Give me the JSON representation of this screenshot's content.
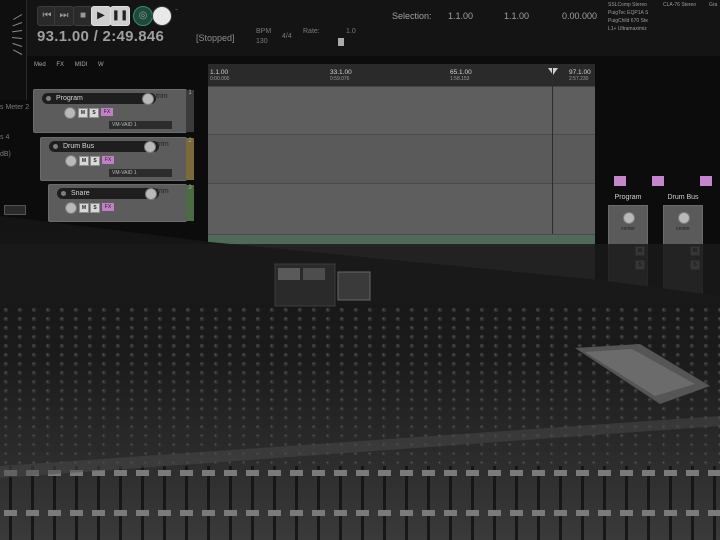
{
  "transport": {
    "time_display": "93.1.00 / 2:49.846",
    "status": "[Stopped]",
    "bpm_label": "BPM",
    "bpm_value": "130",
    "time_sig": "4/4",
    "rate_label": "Rate:",
    "rate_value": "1.0",
    "selection_label": "Selection:",
    "selection_start": "1.1.00",
    "selection_end": "1.1.00",
    "selection_length": "0.00.000"
  },
  "vu_meter": {
    "labels": [
      "s Meter 2",
      "s 4",
      "dB)"
    ]
  },
  "mode_tabs": [
    "Med",
    "FX",
    "MIDI",
    "W"
  ],
  "ruler": {
    "markers": [
      {
        "bar": "1.1.00",
        "time": "0:00.000"
      },
      {
        "bar": "33.1.00",
        "time": "0:59.076"
      },
      {
        "bar": "65.1.00",
        "time": "1:58.153"
      },
      {
        "bar": "97.1.00",
        "time": "2:57.230"
      }
    ]
  },
  "tracks": [
    {
      "name": "Program",
      "number": "1",
      "fx": "FX",
      "vca": "VM-VAID 1",
      "route": "trim",
      "mute": "M",
      "solo": "S"
    },
    {
      "name": "Drum Bus",
      "number": "2",
      "fx": "FX",
      "vca": "VM-VAID 1",
      "route": "trim",
      "mute": "M",
      "solo": "S"
    },
    {
      "name": "Snare",
      "number": "3",
      "fx": "FX",
      "vca": "VM-VAID 1",
      "route": "trim",
      "mute": "M",
      "solo": "S"
    }
  ],
  "plugins": {
    "col1": [
      "SSLComp Stereo",
      "PuigTec EQP1A S",
      "PuigChild 670 Ste",
      "L1+ Ultramaximiz"
    ],
    "col2": [
      "CLA-76 Stereo"
    ],
    "col3": [
      "Gra"
    ]
  },
  "mixer": {
    "strips": [
      {
        "name": "Program",
        "pan": "center",
        "mute": "M",
        "solo": "S"
      },
      {
        "name": "Drum Bus",
        "pan": "center",
        "mute": "M",
        "solo": "S"
      }
    ]
  },
  "colors": {
    "fx_pink": "#c27fc8",
    "panel_gray": "#5c5c5c",
    "background": "#0c0c0c"
  },
  "icons": [
    "skip-back-icon",
    "skip-forward-icon",
    "stop-icon",
    "play-icon",
    "pause-icon",
    "record-icon",
    "loop-icon",
    "marker-icon"
  ]
}
